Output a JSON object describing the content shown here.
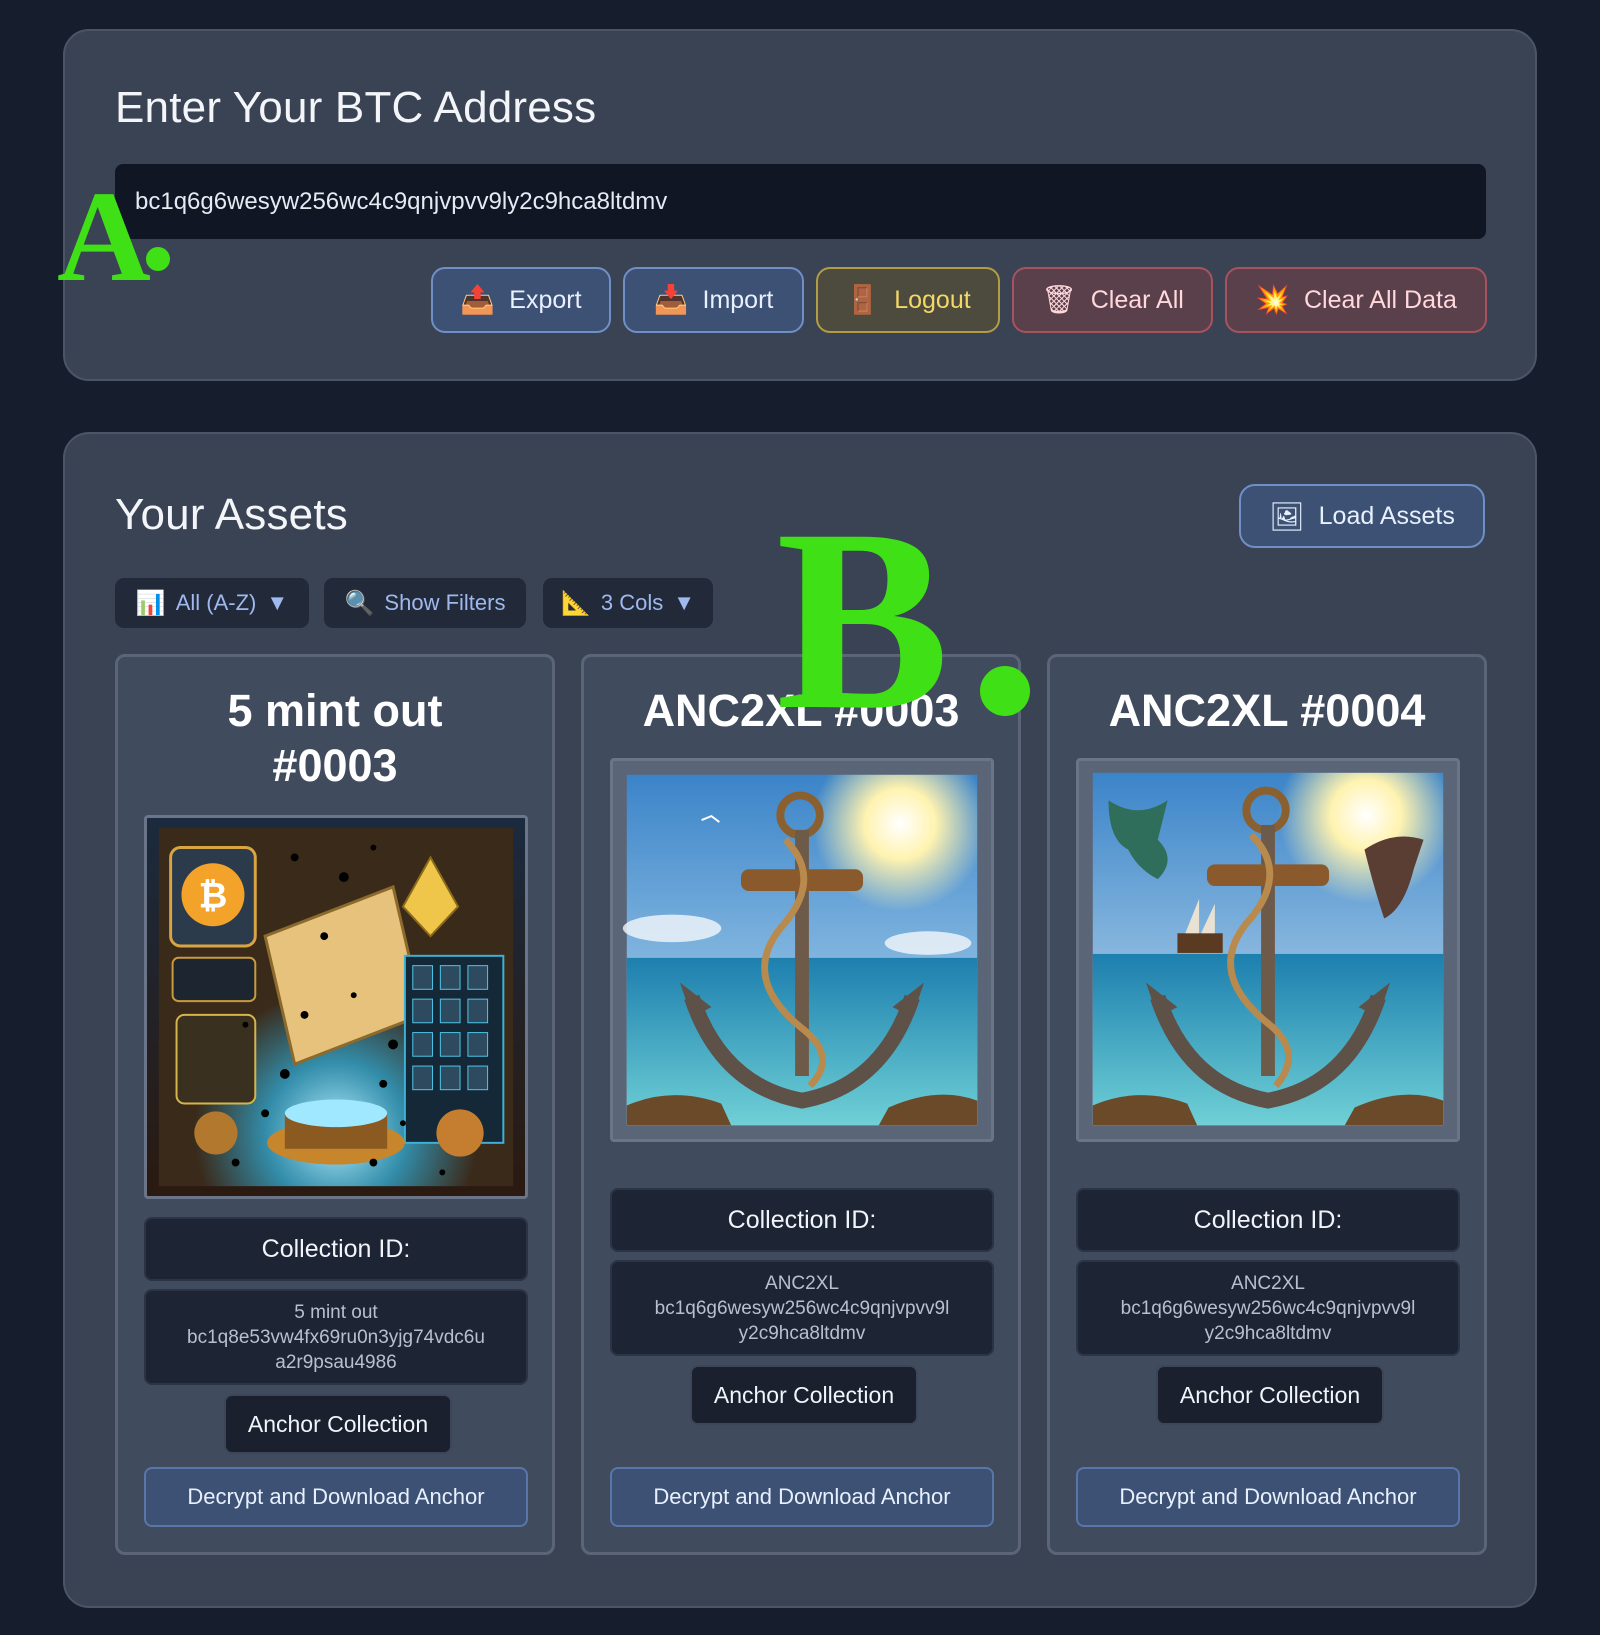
{
  "address_panel": {
    "title": "Enter Your BTC Address",
    "address_value": "bc1q6g6wesyw256wc4c9qnjvpvv9ly2c9hca8ltdmv",
    "buttons": [
      {
        "label": "Export",
        "icon": "outbox-tray-icon",
        "glyph": "📤"
      },
      {
        "label": "Import",
        "icon": "inbox-tray-icon",
        "glyph": "📥"
      },
      {
        "label": "Logout",
        "icon": "door-icon",
        "glyph": "🚪"
      },
      {
        "label": "Clear All",
        "icon": "wastebasket-icon",
        "glyph": "🗑"
      },
      {
        "label": "Clear All Data",
        "icon": "collision-icon",
        "glyph": "💥"
      }
    ]
  },
  "overlay_labels": {
    "a": "A",
    "b": "B"
  },
  "assets_panel": {
    "title": "Your Assets",
    "load_button": {
      "label": "Load Assets",
      "icon": "framed-picture-icon",
      "glyph": "🖼"
    },
    "controls": {
      "sort": {
        "label": "All (A-Z)",
        "icon": "bar-chart-icon",
        "glyph": "📊",
        "caret": "▼"
      },
      "filters": {
        "label": "Show Filters",
        "icon": "magnifier-icon",
        "glyph": "🔍"
      },
      "columns": {
        "label": "3 Cols",
        "icon": "triangle-ruler-icon",
        "glyph": "📐",
        "caret": "▼"
      }
    },
    "cards": [
      {
        "title_line1": "5 mint out",
        "title_line2": "#0003",
        "collection_label": "Collection ID:",
        "collection_line1": "5 mint out",
        "collection_line2": "bc1q8e53vw4fx69ru0n3yjg74vdc6u",
        "collection_line3": "a2r9psau4986",
        "anchor_label": "Anchor Collection",
        "decrypt_label": "Decrypt and Download Anchor"
      },
      {
        "title_line1": "ANC2XL #0003",
        "collection_label": "Collection ID:",
        "collection_line1": "ANC2XL",
        "collection_line2": "bc1q6g6wesyw256wc4c9qnjvpvv9l",
        "collection_line3": "y2c9hca8ltdmv",
        "anchor_label": "Anchor Collection",
        "decrypt_label": "Decrypt and Download Anchor"
      },
      {
        "title_line1": "ANC2XL #0004",
        "collection_label": "Collection ID:",
        "collection_line1": "ANC2XL",
        "collection_line2": "bc1q6g6wesyw256wc4c9qnjvpvv9l",
        "collection_line3": "y2c9hca8ltdmv",
        "anchor_label": "Anchor Collection",
        "decrypt_label": "Decrypt and Download Anchor"
      }
    ]
  }
}
